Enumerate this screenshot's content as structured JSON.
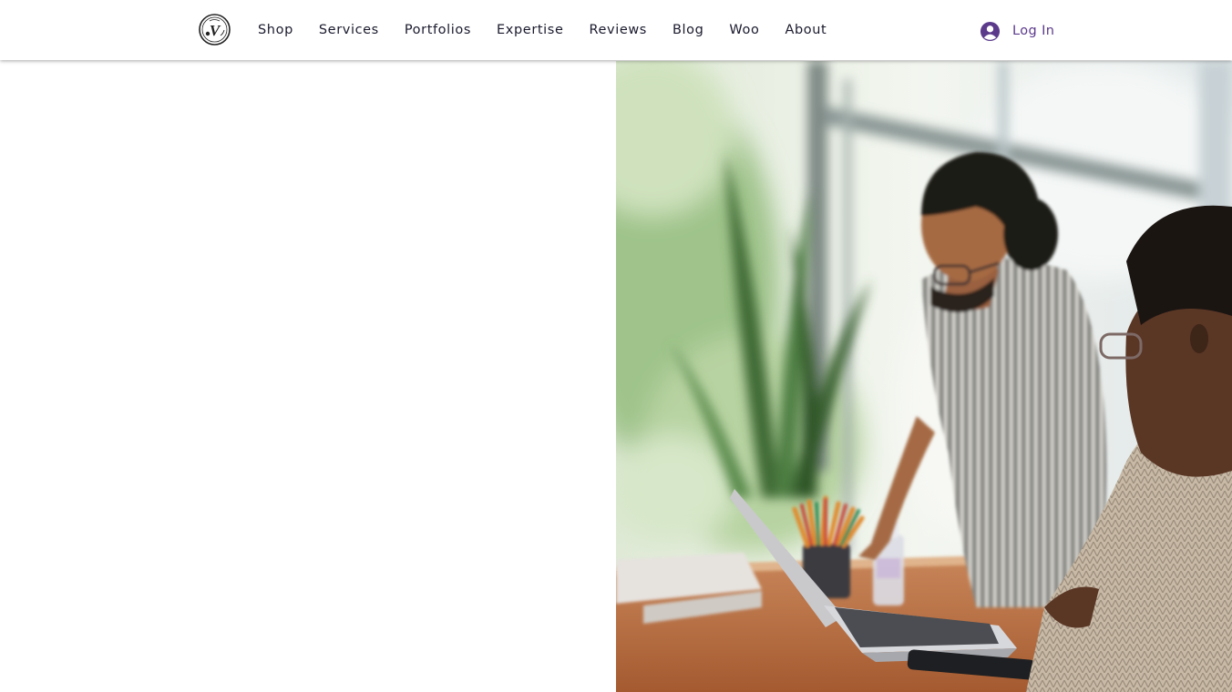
{
  "header": {
    "logo_icon": "monogram-v-logo",
    "nav": [
      {
        "label": "Shop"
      },
      {
        "label": "Services"
      },
      {
        "label": "Portfolios"
      },
      {
        "label": "Expertise"
      },
      {
        "label": "Reviews"
      },
      {
        "label": "Blog"
      },
      {
        "label": "Woo"
      },
      {
        "label": "About"
      }
    ],
    "login": {
      "label": "Log In",
      "icon": "user-avatar-icon",
      "accent_color": "#5b3a8c"
    }
  },
  "hero": {
    "image": "photo-two-people-working-at-laptop"
  }
}
